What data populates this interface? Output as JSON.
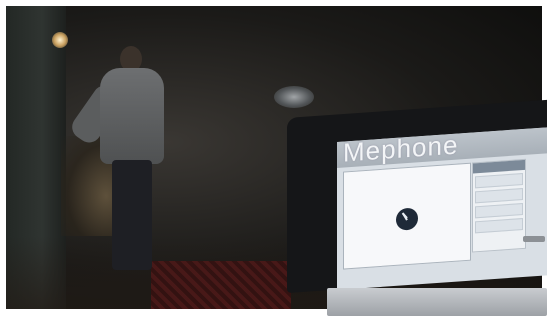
{
  "scene": {
    "kind": "photo",
    "screen": {
      "brand": "Mephone",
      "dialog": {
        "title": "",
        "message": "",
        "footer": ""
      },
      "sidebar": {
        "header": "",
        "items": [
          "",
          "",
          "",
          ""
        ]
      }
    }
  }
}
